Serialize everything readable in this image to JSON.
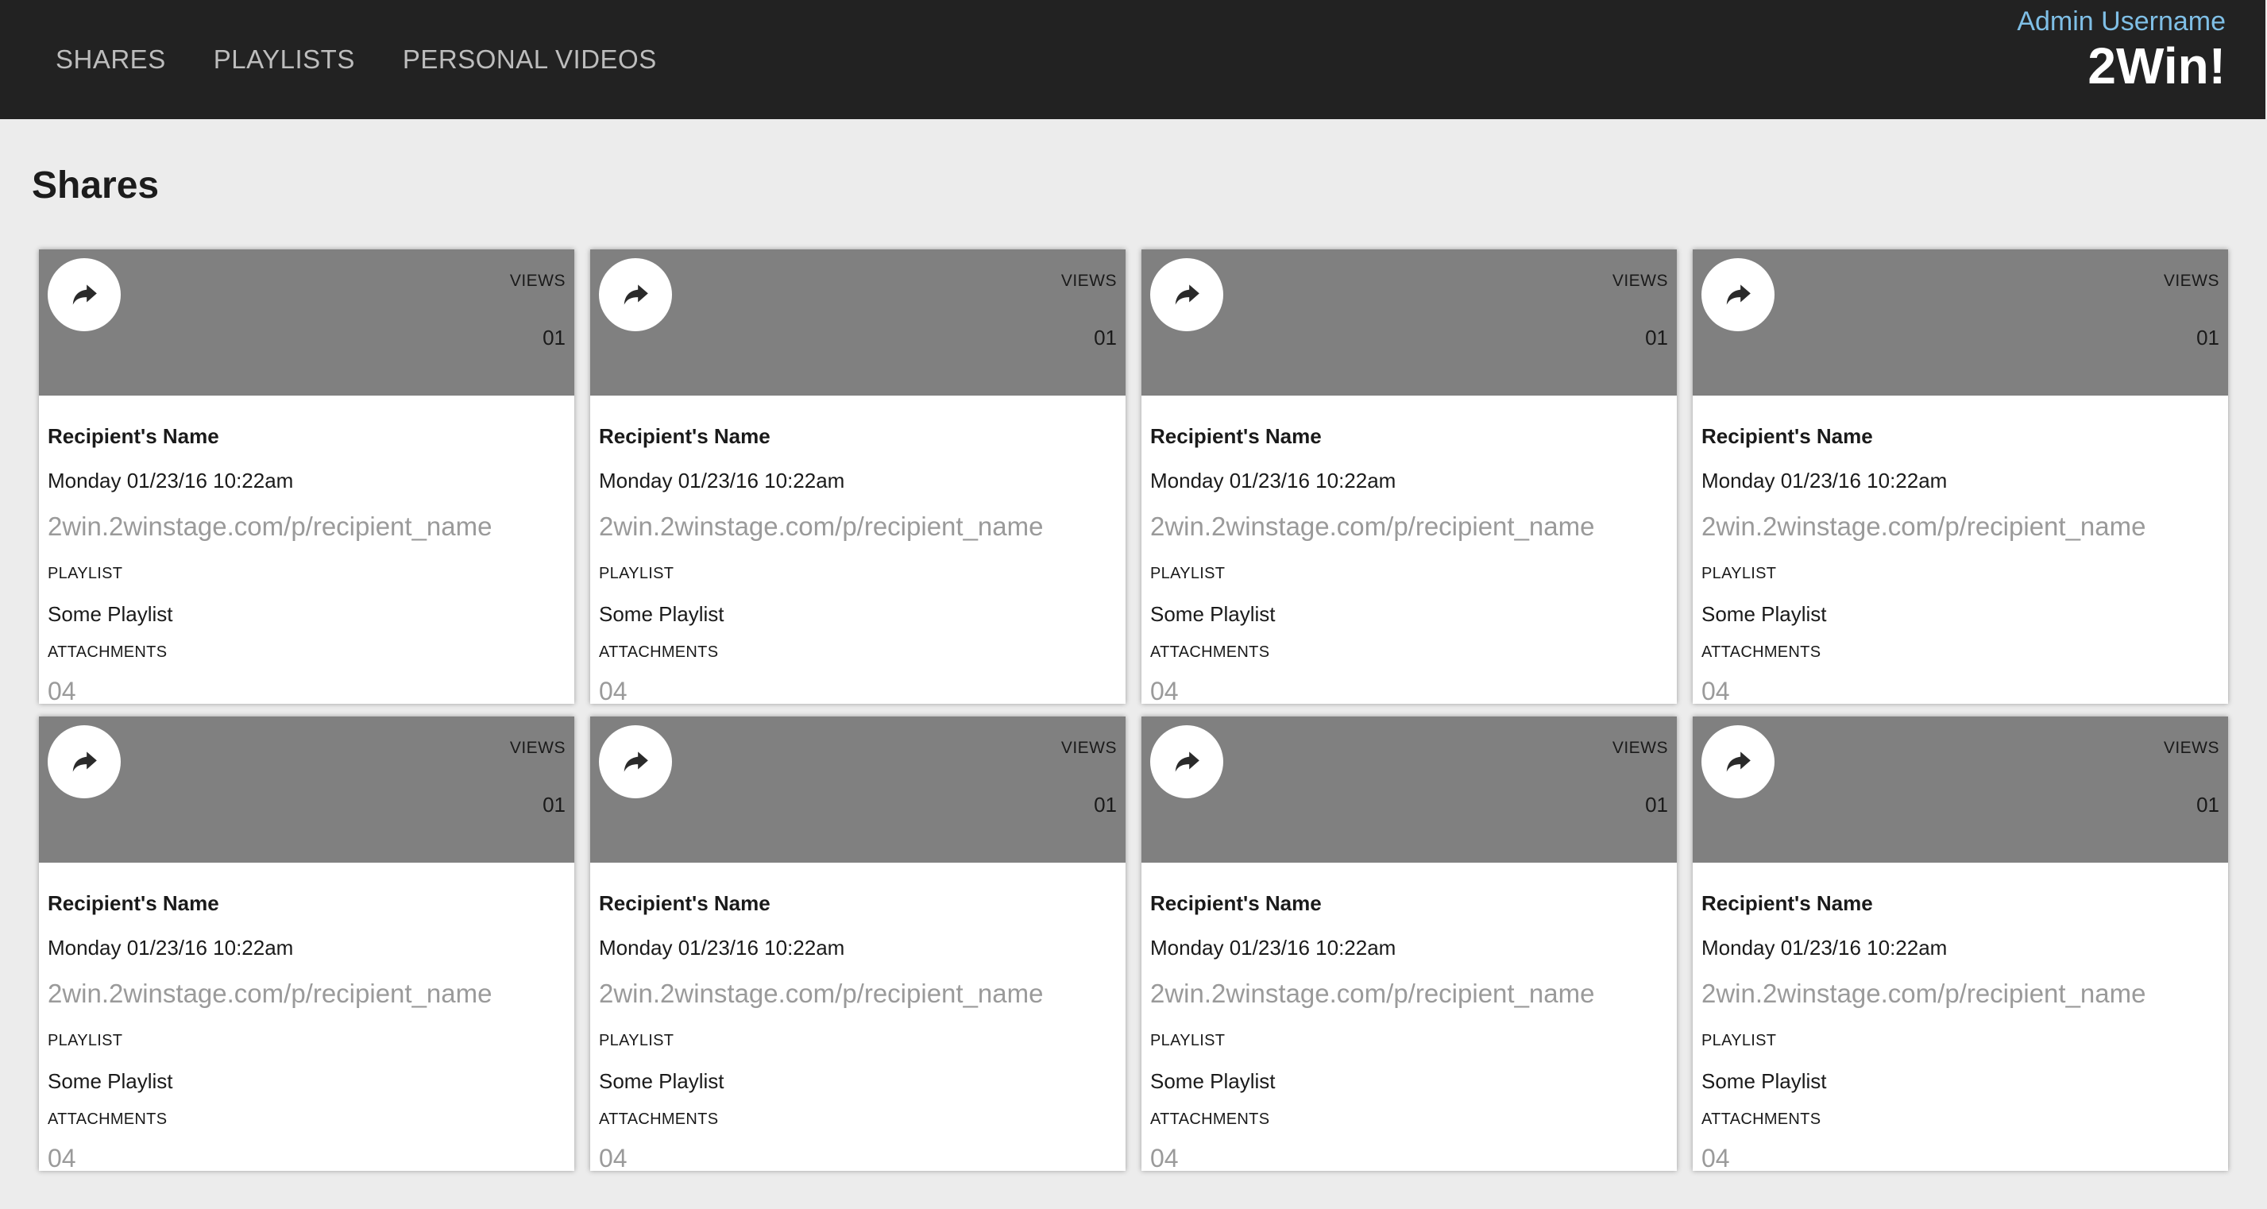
{
  "nav": {
    "items": [
      {
        "label": "SHARES"
      },
      {
        "label": "PLAYLISTS"
      },
      {
        "label": "PERSONAL VIDEOS"
      }
    ]
  },
  "user": {
    "name": "Admin Username"
  },
  "brand": {
    "name": "2Win!"
  },
  "page": {
    "title": "Shares"
  },
  "labels": {
    "views": "VIEWS",
    "playlist": "PLAYLIST",
    "attachments": "ATTACHMENTS"
  },
  "icons": {
    "share": "share-arrow-icon"
  },
  "colors": {
    "topbar": "#222222",
    "card_header": "#808080",
    "user_link": "#7fbfe6",
    "muted_text": "#9a9a9a"
  },
  "cards": [
    {
      "views": "01",
      "recipient": "Recipient's Name",
      "date": "Monday 01/23/16 10:22am",
      "link": "2win.2winstage.com/p/recipient_name",
      "playlist": "Some Playlist",
      "attachments": "04"
    },
    {
      "views": "01",
      "recipient": "Recipient's Name",
      "date": "Monday 01/23/16 10:22am",
      "link": "2win.2winstage.com/p/recipient_name",
      "playlist": "Some Playlist",
      "attachments": "04"
    },
    {
      "views": "01",
      "recipient": "Recipient's Name",
      "date": "Monday 01/23/16 10:22am",
      "link": "2win.2winstage.com/p/recipient_name",
      "playlist": "Some Playlist",
      "attachments": "04"
    },
    {
      "views": "01",
      "recipient": "Recipient's Name",
      "date": "Monday 01/23/16 10:22am",
      "link": "2win.2winstage.com/p/recipient_name",
      "playlist": "Some Playlist",
      "attachments": "04"
    },
    {
      "views": "01",
      "recipient": "Recipient's Name",
      "date": "Monday 01/23/16 10:22am",
      "link": "2win.2winstage.com/p/recipient_name",
      "playlist": "Some Playlist",
      "attachments": "04"
    },
    {
      "views": "01",
      "recipient": "Recipient's Name",
      "date": "Monday 01/23/16 10:22am",
      "link": "2win.2winstage.com/p/recipient_name",
      "playlist": "Some Playlist",
      "attachments": "04"
    },
    {
      "views": "01",
      "recipient": "Recipient's Name",
      "date": "Monday 01/23/16 10:22am",
      "link": "2win.2winstage.com/p/recipient_name",
      "playlist": "Some Playlist",
      "attachments": "04"
    },
    {
      "views": "01",
      "recipient": "Recipient's Name",
      "date": "Monday 01/23/16 10:22am",
      "link": "2win.2winstage.com/p/recipient_name",
      "playlist": "Some Playlist",
      "attachments": "04"
    }
  ]
}
